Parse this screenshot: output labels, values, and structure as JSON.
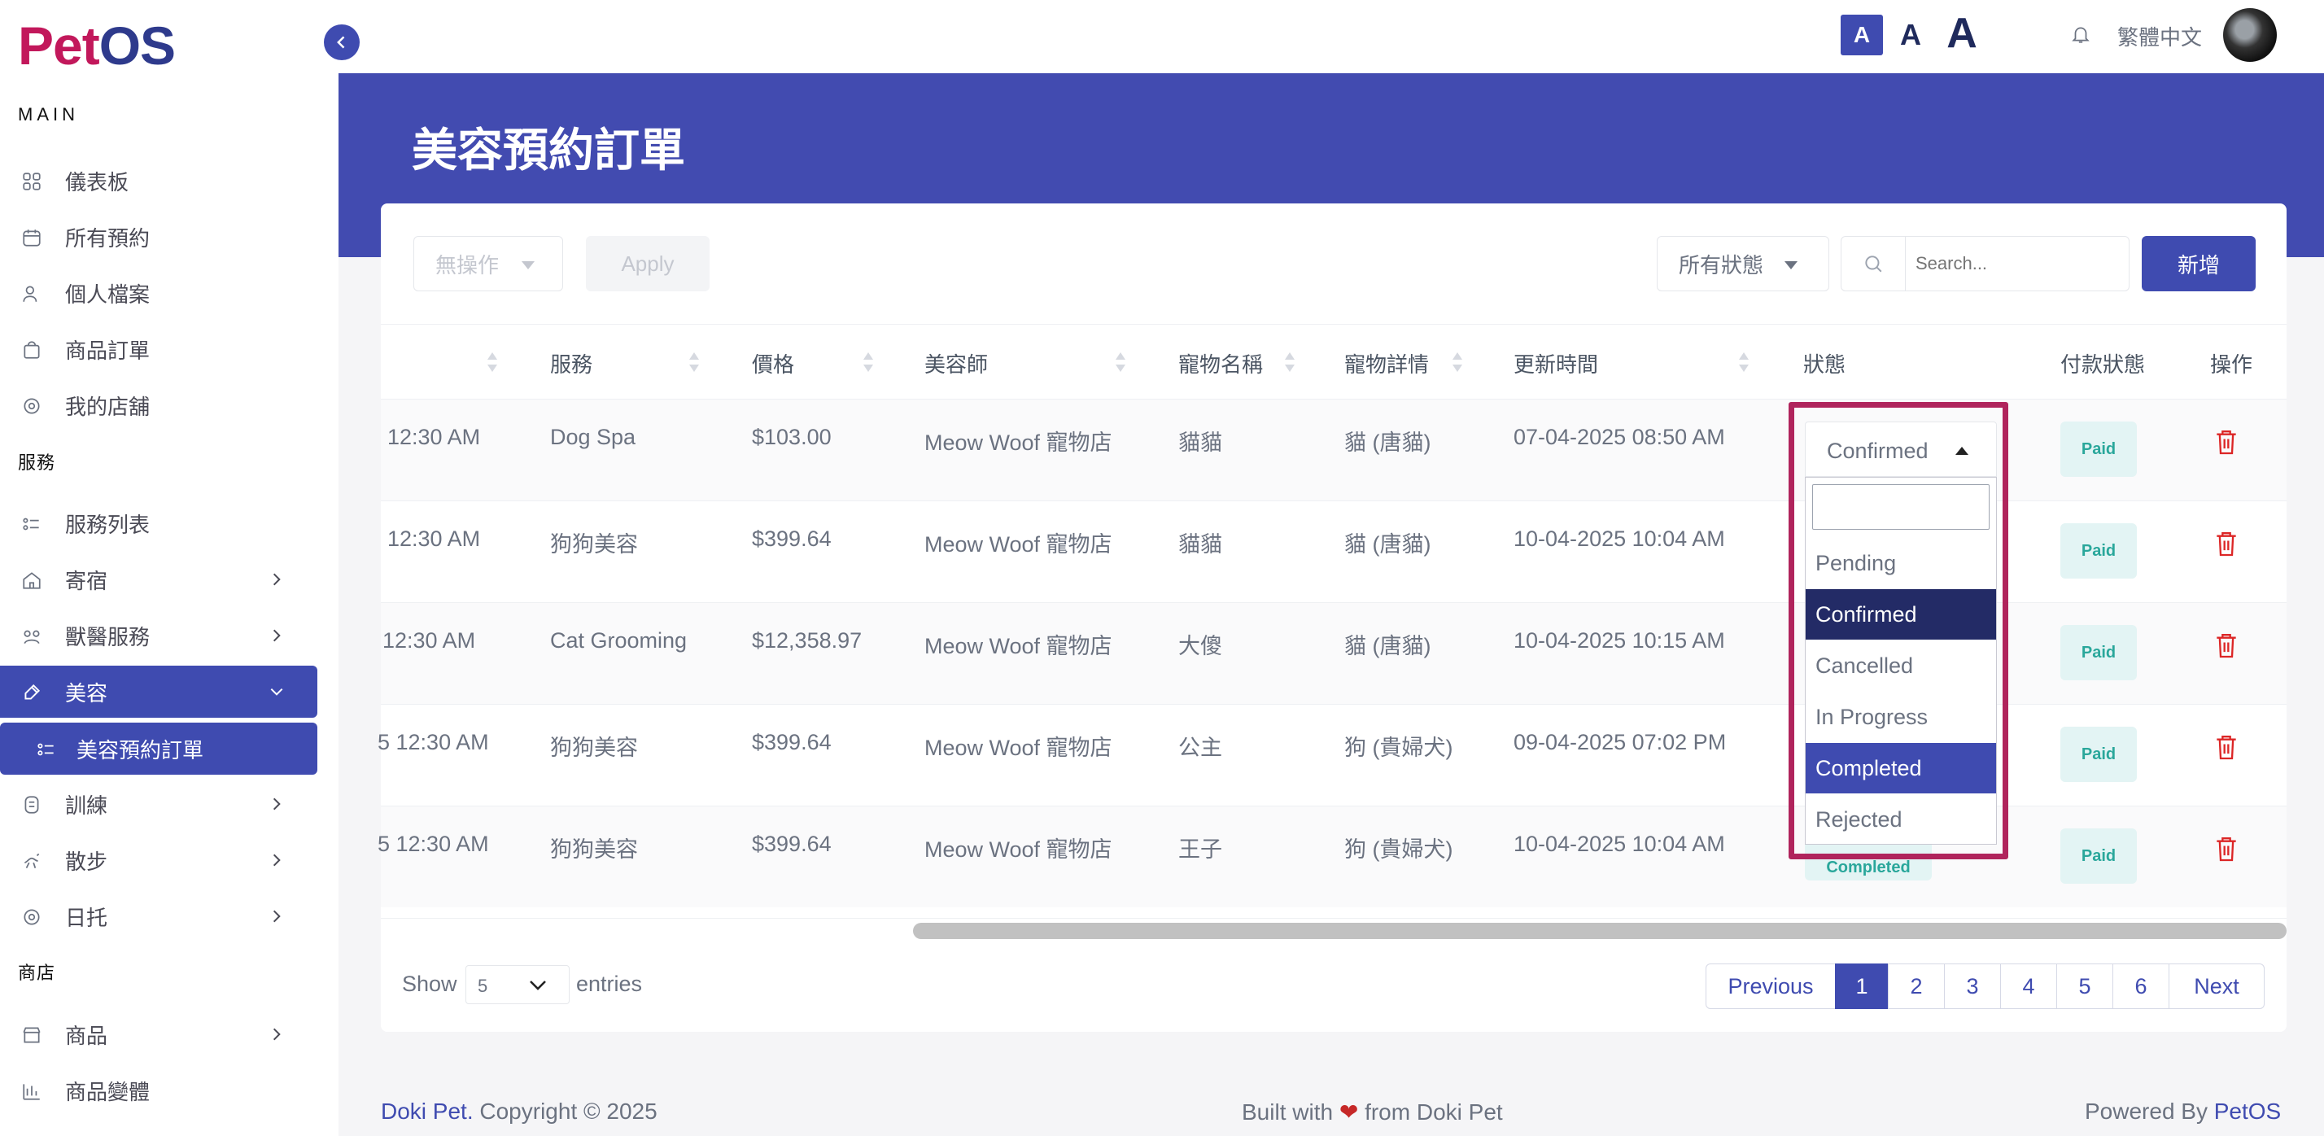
{
  "brand": {
    "logo_prefix": "Pet",
    "logo_suffix": "OS",
    "colors": {
      "primary": "#3f4bb0",
      "accent": "#c2185b",
      "highlight_border": "#b0245c"
    }
  },
  "sidebar": {
    "section_main": "MAIN",
    "main_items": [
      {
        "label": "儀表板",
        "icon": "dashboard-grid-icon"
      },
      {
        "label": "所有預約",
        "icon": "calendar-icon"
      },
      {
        "label": "個人檔案",
        "icon": "user-icon"
      },
      {
        "label": "商品訂單",
        "icon": "shopping-bag-icon"
      },
      {
        "label": "我的店舖",
        "icon": "store-icon"
      }
    ],
    "section_services": "服務",
    "service_items": [
      {
        "label": "服務列表",
        "icon": "list-icon"
      },
      {
        "label": "寄宿",
        "icon": "house-icon"
      },
      {
        "label": "獸醫服務",
        "icon": "vet-icon"
      },
      {
        "label": "美容",
        "icon": "grooming-brush-icon"
      },
      {
        "label": "美容預約訂單",
        "icon": "list-icon"
      },
      {
        "label": "訓練",
        "icon": "training-icon"
      },
      {
        "label": "散步",
        "icon": "walking-icon"
      },
      {
        "label": "日托",
        "icon": "daycare-icon"
      }
    ],
    "section_shop": "商店",
    "shop_items": [
      {
        "label": "商品",
        "icon": "store-icon"
      },
      {
        "label": "商品變體",
        "icon": "variants-icon"
      }
    ]
  },
  "header": {
    "font_sizes": [
      "A",
      "A",
      "A"
    ],
    "language": "繁體中文"
  },
  "page": {
    "title": "美容預約訂單"
  },
  "toolbar": {
    "bulk_action": "無操作",
    "apply": "Apply",
    "status_filter": "所有狀態",
    "search_placeholder": "Search...",
    "add_new": "新增"
  },
  "table": {
    "headers": [
      "服務",
      "價格",
      "美容師",
      "寵物名稱",
      "寵物詳情",
      "更新時間",
      "狀態",
      "付款狀態",
      "操作"
    ],
    "rows": [
      {
        "time": "12:30 AM",
        "service": "Dog Spa",
        "price": "$103.00",
        "groomer": "Meow Woof 寵物店",
        "pet": "貓貓",
        "details": "貓 (唐貓)",
        "updated": "07-04-2025 08:50 AM",
        "status": "Confirmed",
        "payment": "Paid"
      },
      {
        "time": "12:30 AM",
        "service": "狗狗美容",
        "price": "$399.64",
        "groomer": "Meow Woof 寵物店",
        "pet": "貓貓",
        "details": "貓 (唐貓)",
        "updated": "10-04-2025 10:04 AM",
        "status": "",
        "payment": "Paid"
      },
      {
        "time": "12:30 AM",
        "service": "Cat Grooming",
        "price": "$12,358.97",
        "groomer": "Meow Woof 寵物店",
        "pet": "大傻",
        "details": "貓 (唐貓)",
        "updated": "10-04-2025 10:15 AM",
        "status": "",
        "payment": "Paid"
      },
      {
        "time": "5 12:30 AM",
        "service": "狗狗美容",
        "price": "$399.64",
        "groomer": "Meow Woof 寵物店",
        "pet": "公主",
        "details": "狗 (貴婦犬)",
        "updated": "09-04-2025 07:02 PM",
        "status": "",
        "payment": "Paid"
      },
      {
        "time": "5 12:30 AM",
        "service": "狗狗美容",
        "price": "$399.64",
        "groomer": "Meow Woof 寵物店",
        "pet": "王子",
        "details": "狗 (貴婦犬)",
        "updated": "10-04-2025 10:04 AM",
        "status": "Completed",
        "payment": "Paid"
      }
    ]
  },
  "status_dropdown": {
    "selected": "Confirmed",
    "options": [
      "Pending",
      "Confirmed",
      "Cancelled",
      "In Progress",
      "Completed"
    ],
    "last_option": "Rejected"
  },
  "pagination": {
    "show": "Show",
    "entries_value": "5",
    "entries": "entries",
    "previous": "Previous",
    "pages": [
      "1",
      "2",
      "3",
      "4",
      "5",
      "6"
    ],
    "next": "Next",
    "current_page": "1"
  },
  "footer": {
    "brand": "Doki Pet.",
    "copyright": " Copyright © 2025",
    "built_prefix": "Built with",
    "built_suffix": "from Doki Pet",
    "powered_prefix": "Powered By",
    "powered_brand": "PetOS"
  }
}
